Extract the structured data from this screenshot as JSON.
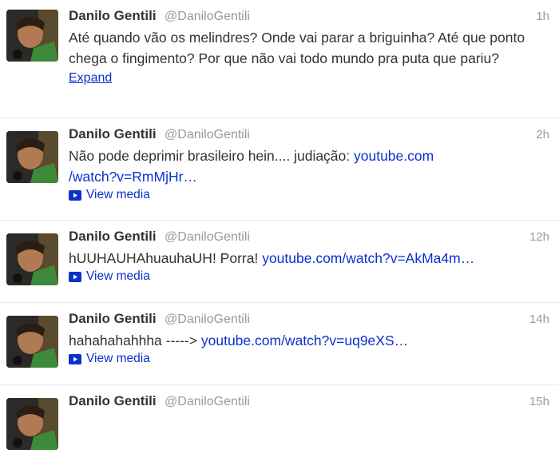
{
  "tweets": [
    {
      "name": "Danilo Gentili",
      "handle": "@DaniloGentili",
      "time": "1h",
      "text": "Até quando vão os melindres? Onde vai parar a briguinha? Até que ponto chega o fingimento? Por que não vai todo mundo pra puta que pariu?",
      "action": "Expand"
    },
    {
      "name": "Danilo Gentili",
      "handle": "@DaniloGentili",
      "time": "2h",
      "text": "Não pode deprimir brasileiro hein.... judiação: ",
      "link_line1": "youtube.com",
      "link_line2": "/watch?v=RmMjHr…",
      "action": "View media"
    },
    {
      "name": "Danilo Gentili",
      "handle": "@DaniloGentili",
      "time": "12h",
      "text": "hUUHAUHAhuauhaUH! Porra! ",
      "link": "youtube.com/watch?v=AkMa4m…",
      "action": "View media"
    },
    {
      "name": "Danilo Gentili",
      "handle": "@DaniloGentili",
      "time": "14h",
      "text": "hahahahahhha -----> ",
      "link": "youtube.com/watch?v=uq9eXS…",
      "action": "View media"
    },
    {
      "name": "Danilo Gentili",
      "handle": "@DaniloGentili",
      "time": "15h"
    }
  ],
  "icons": {
    "media": "play-icon",
    "avatar": "avatar-photo"
  },
  "colors": {
    "link": "#0b31cc",
    "name": "#333333",
    "muted": "#999999"
  }
}
